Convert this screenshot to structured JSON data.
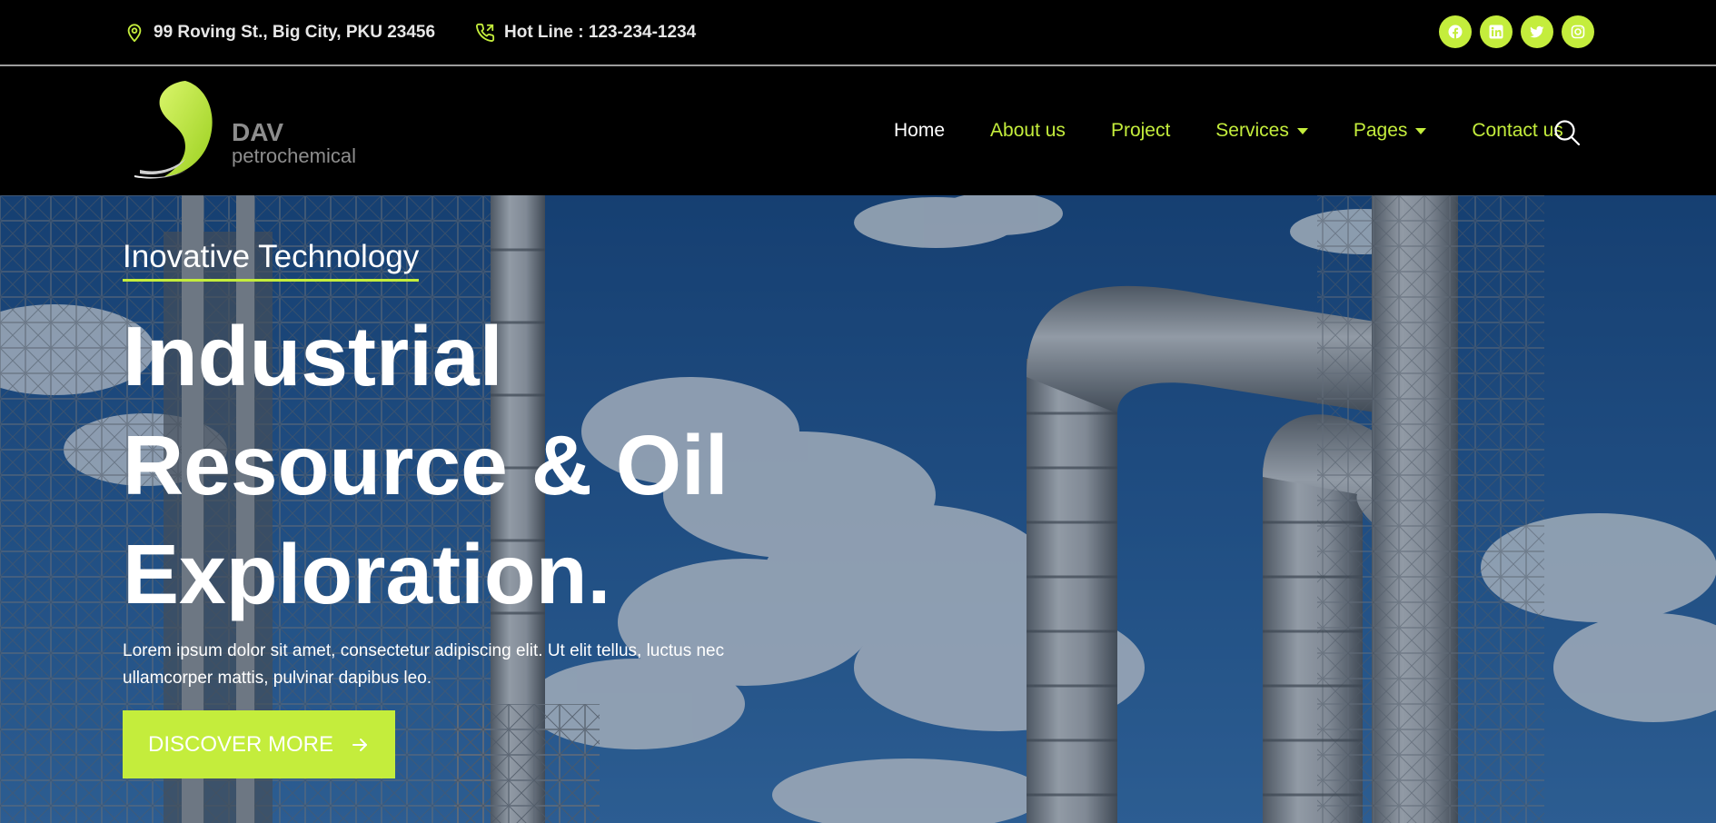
{
  "topbar": {
    "address": "99 Roving St., Big City, PKU 23456",
    "address_icon": "map-pin-icon",
    "hotline": "Hot Line : 123-234-1234",
    "hotline_icon": "phone-icon",
    "social": [
      "facebook-icon",
      "linkedin-icon",
      "twitter-icon",
      "instagram-icon"
    ]
  },
  "header": {
    "logo": {
      "brand": "DAV",
      "sub": "petrochemical"
    },
    "nav": [
      {
        "label": "Home",
        "active": true
      },
      {
        "label": "About us"
      },
      {
        "label": "Project"
      },
      {
        "label": "Services",
        "dropdown": true
      },
      {
        "label": "Pages",
        "dropdown": true
      },
      {
        "label": "Contact us"
      }
    ],
    "search_icon": "search-icon"
  },
  "hero": {
    "eyebrow": "Inovative Technology",
    "headline_line1": "Industrial",
    "headline_line2": "Resource & Oil",
    "headline_line3": "Exploration.",
    "lead_line1": "Lorem ipsum dolor sit amet, consectetur adipiscing elit. Ut elit tellus, luctus nec",
    "lead_line2": "ullamcorper mattis, pulvinar dapibus leo.",
    "cta_label": "DISCOVER MORE",
    "cta_icon": "arrow-right-icon"
  },
  "colors": {
    "accent": "#c4ed3c",
    "topbar_bg": "#000000",
    "header_bg": "#000000",
    "text_light": "#ffffff",
    "logo_text": "#8d8d8d"
  }
}
